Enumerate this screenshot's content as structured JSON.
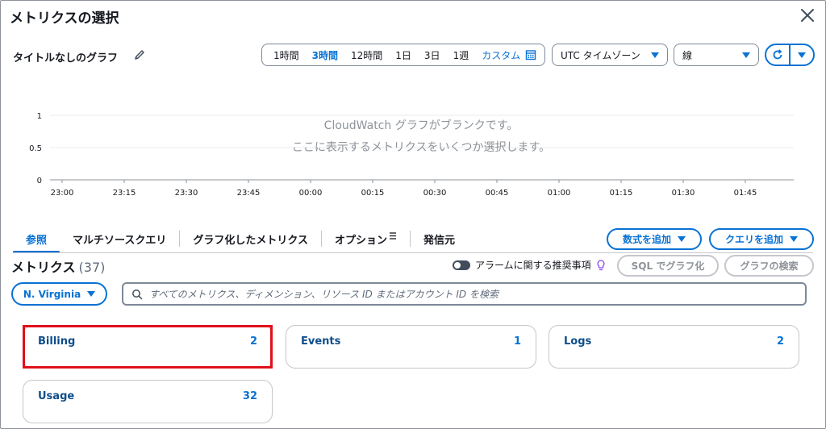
{
  "modal": {
    "title": "メトリクスの選択"
  },
  "graph": {
    "title": "タイトルなしのグラフ"
  },
  "time_range": {
    "options": [
      "1時間",
      "3時間",
      "12時間",
      "1日",
      "3日",
      "1週"
    ],
    "selected": "3時間",
    "custom_label": "カスタム"
  },
  "timezone": {
    "value": "UTC タイムゾーン"
  },
  "graph_type": {
    "value": "線"
  },
  "chart_data": {
    "type": "line",
    "x": [
      "23:00",
      "23:15",
      "23:30",
      "23:45",
      "00:00",
      "00:15",
      "00:30",
      "00:45",
      "01:00",
      "01:15",
      "01:30",
      "01:45"
    ],
    "series": [],
    "ylim": [
      0,
      1
    ],
    "yticks": [
      "0",
      "0.5",
      "1"
    ],
    "empty_message_line1": "CloudWatch グラフがブランクです。",
    "empty_message_line2": "ここに表示するメトリクスをいくつか選択します。",
    "grid": true
  },
  "tabs": [
    {
      "label": "参照",
      "active": true
    },
    {
      "label": "マルチソースクエリ",
      "active": false
    },
    {
      "label": "グラフ化したメトリクス",
      "active": false
    },
    {
      "label": "オプション",
      "active": false
    },
    {
      "label": "発信元",
      "active": false
    }
  ],
  "buttons": {
    "add_formula": "数式を追加",
    "add_query": "クエリを追加",
    "sql_graph": "SQL でグラフ化",
    "search_graph": "グラフの検索"
  },
  "metrics": {
    "title": "メトリクス",
    "count": "(37)",
    "alarm_toggle_label": "アラームに関する推奨事項"
  },
  "region": {
    "value": "N. Virginia"
  },
  "search": {
    "placeholder": "すべてのメトリクス、ディメンション、リソース ID またはアカウント ID を検索"
  },
  "namespaces": [
    {
      "name": "Billing",
      "count": "2"
    },
    {
      "name": "Events",
      "count": "1"
    },
    {
      "name": "Logs",
      "count": "2"
    },
    {
      "name": "Usage",
      "count": "32"
    }
  ],
  "colors": {
    "accent": "#0972d3",
    "highlight": "#e0101a"
  }
}
